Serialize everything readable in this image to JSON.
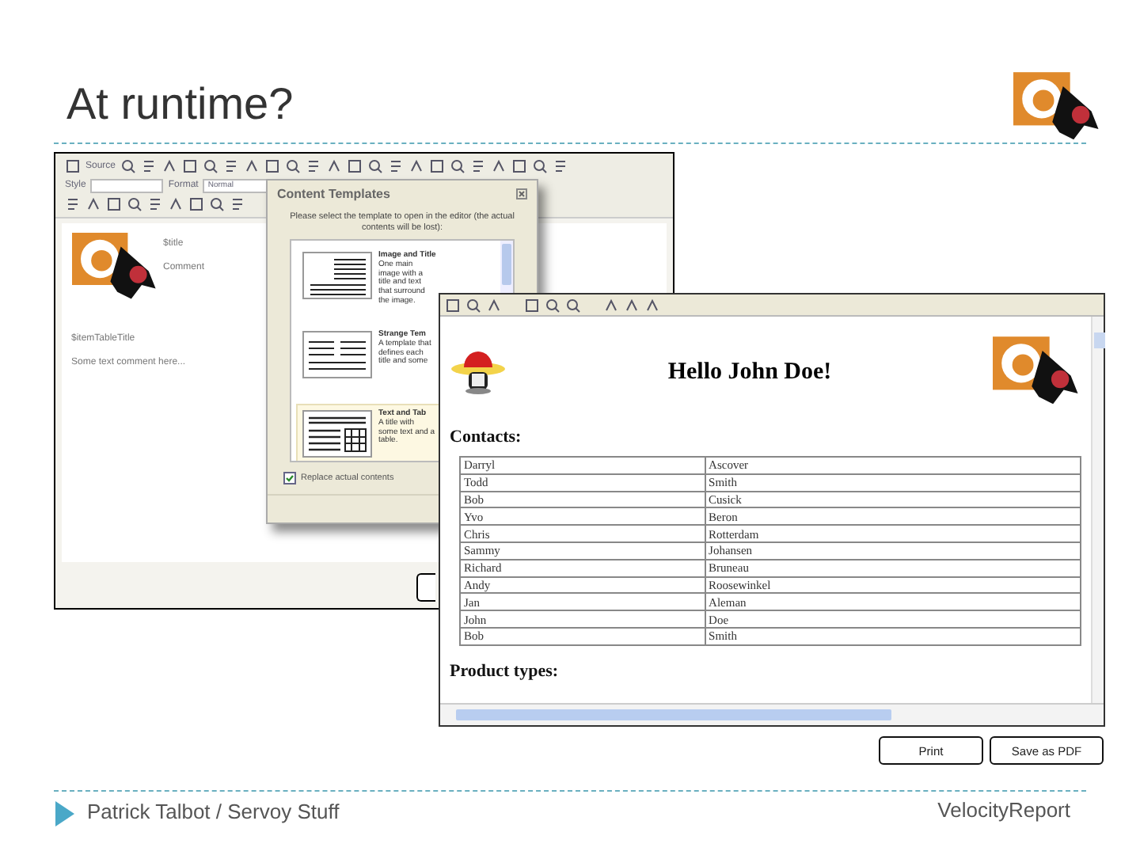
{
  "slide": {
    "title": "At runtime?"
  },
  "editor": {
    "toolbar": {
      "source_label": "Source",
      "style_label": "Style",
      "format_label": "Format",
      "format_value": "Normal"
    },
    "content": {
      "title_field": "$title",
      "comment_field": "Comment",
      "table_title": "$itemTableTitle",
      "body_text": "Some text comment here..."
    }
  },
  "dialog": {
    "title": "Content Templates",
    "instructions": "Please select the template to open in the editor (the actual contents will be lost):",
    "templates": [
      {
        "title": "Image and Title",
        "description": "One main image with a title and text that surround the image.",
        "kind": "image",
        "selected": false
      },
      {
        "title": "Strange Tem",
        "description": "A template that defines each title and some",
        "kind": "columns",
        "selected": false
      },
      {
        "title": "Text and Tab",
        "description": "A title with some text and a table.",
        "kind": "table",
        "selected": true
      }
    ],
    "replace_checkbox": {
      "label": "Replace actual contents",
      "checked": true
    }
  },
  "report": {
    "heading": "Hello John Doe!",
    "contacts_label": "Contacts:",
    "contacts": [
      [
        "Darryl",
        "Ascover"
      ],
      [
        "Todd",
        "Smith"
      ],
      [
        "Bob",
        "Cusick"
      ],
      [
        "Yvo",
        "Beron"
      ],
      [
        "Chris",
        "Rotterdam"
      ],
      [
        "Sammy",
        "Johansen"
      ],
      [
        "Richard",
        "Bruneau"
      ],
      [
        "Andy",
        "Roosewinkel"
      ],
      [
        "Jan",
        "Aleman"
      ],
      [
        "John",
        "Doe"
      ],
      [
        "Bob",
        "Smith"
      ]
    ],
    "products_label": "Product types:"
  },
  "buttons": [
    "Print",
    "Save as PDF"
  ],
  "footer": {
    "author": "Patrick Talbot / Servoy Stuff",
    "project": "VelocityReport"
  }
}
